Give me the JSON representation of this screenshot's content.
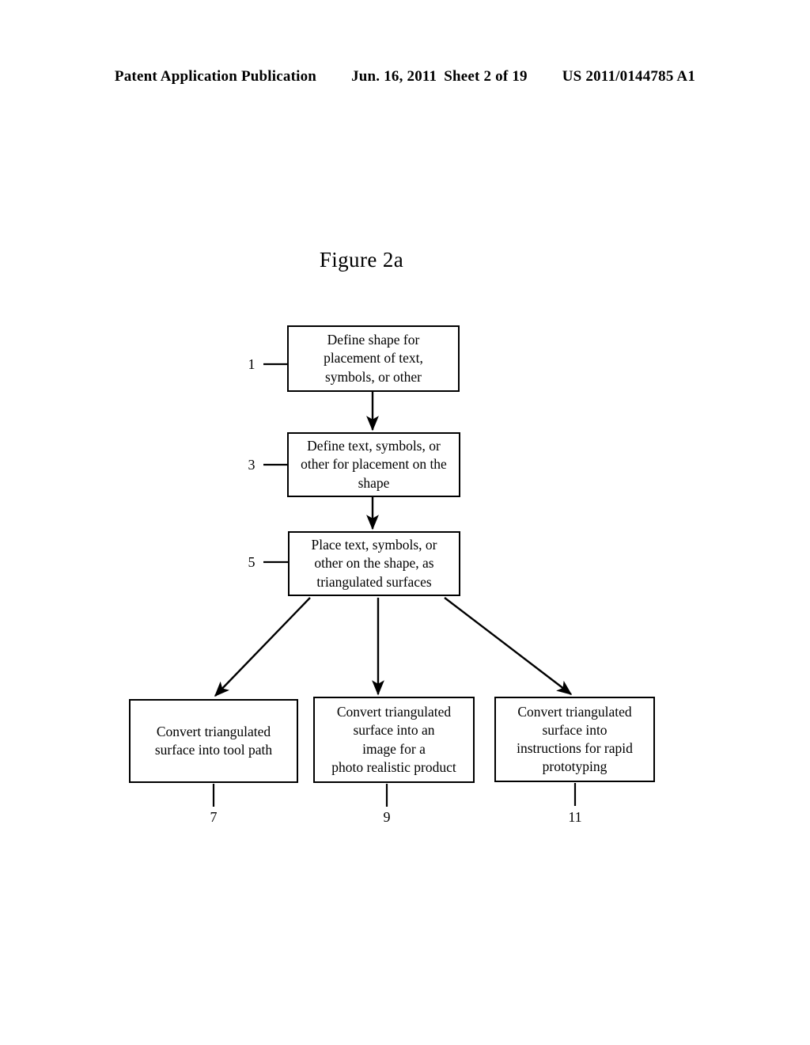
{
  "header": {
    "publication": "Patent Application Publication",
    "date": "Jun. 16, 2011",
    "sheet": "Sheet 2 of 19",
    "patent_number": "US 2011/0144785 A1"
  },
  "figure": {
    "title": "Figure 2a"
  },
  "flowchart": {
    "boxes": [
      {
        "ref": "1",
        "text": "Define shape for\nplacement of text,\nsymbols, or other"
      },
      {
        "ref": "3",
        "text": "Define text, symbols, or\nother for placement on the\nshape"
      },
      {
        "ref": "5",
        "text": "Place text, symbols, or\nother on the shape, as\ntriangulated surfaces"
      },
      {
        "ref": "7",
        "text": "Convert triangulated\nsurface into tool path"
      },
      {
        "ref": "9",
        "text": "Convert triangulated\nsurface into an\nimage for a\nphoto realistic product"
      },
      {
        "ref": "11",
        "text": "Convert triangulated\nsurface into\ninstructions for rapid\nprototyping"
      }
    ],
    "refs": {
      "one": "1",
      "three": "3",
      "five": "5",
      "seven": "7",
      "nine": "9",
      "eleven": "11"
    },
    "colors": {
      "stroke": "#000000",
      "background": "#ffffff"
    }
  }
}
